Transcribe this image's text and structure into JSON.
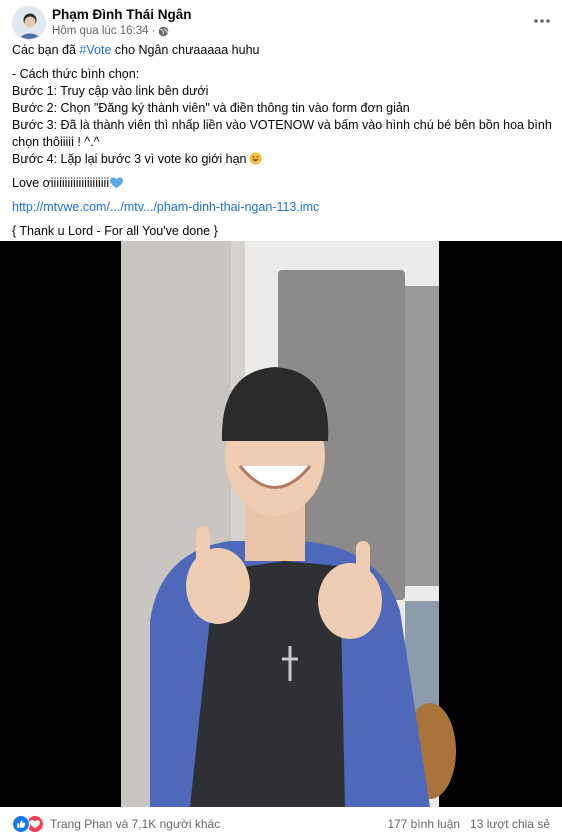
{
  "post": {
    "author": "Phạm Đình Thái Ngân",
    "timestamp": "Hôm qua lúc 16:34",
    "timestamp_sep": "·",
    "privacy_icon": "globe-icon",
    "more_icon": "more-horizontal-icon",
    "lines": {
      "intro_pre": "Các bạn đã ",
      "hashtag": "#Vote",
      "intro_post": " cho Ngân chưaaaaa huhu",
      "how_title": " - Cách thức bình chọn:",
      "step1": "Bước 1: Truy cập vào link bên dưới",
      "step2": "Bước 2: Chọn \"Đăng ký thành viên\" và điền thông tin vào form đơn giản",
      "step3": "Bước 3: Đã là thành viên thì nhấp liền vào VOTENOW và bấm vào hình chú bé bên bồn hoa bình chọn thôiiiii ! ^.^",
      "step4": "Bước 4: Lặp lại bước 3 vì vote ko giới hạn",
      "love": "Love ơiiiiiiiiiiiiiiiiiiiii",
      "link": "http://mtvwe.com/.../mtv.../pham-dinh-thai-ngan-113.imc",
      "closing": "{ Thank u Lord - For all You've done }"
    }
  },
  "footer": {
    "reaction_names": "Trang Phan và 7,1K người khác",
    "comments": "177 bình luận",
    "shares": "13 lượt chia sẻ"
  },
  "colors": {
    "link": "#216fdb",
    "like": "#1877f2",
    "love": "#f33e58",
    "muted": "#65676b"
  }
}
